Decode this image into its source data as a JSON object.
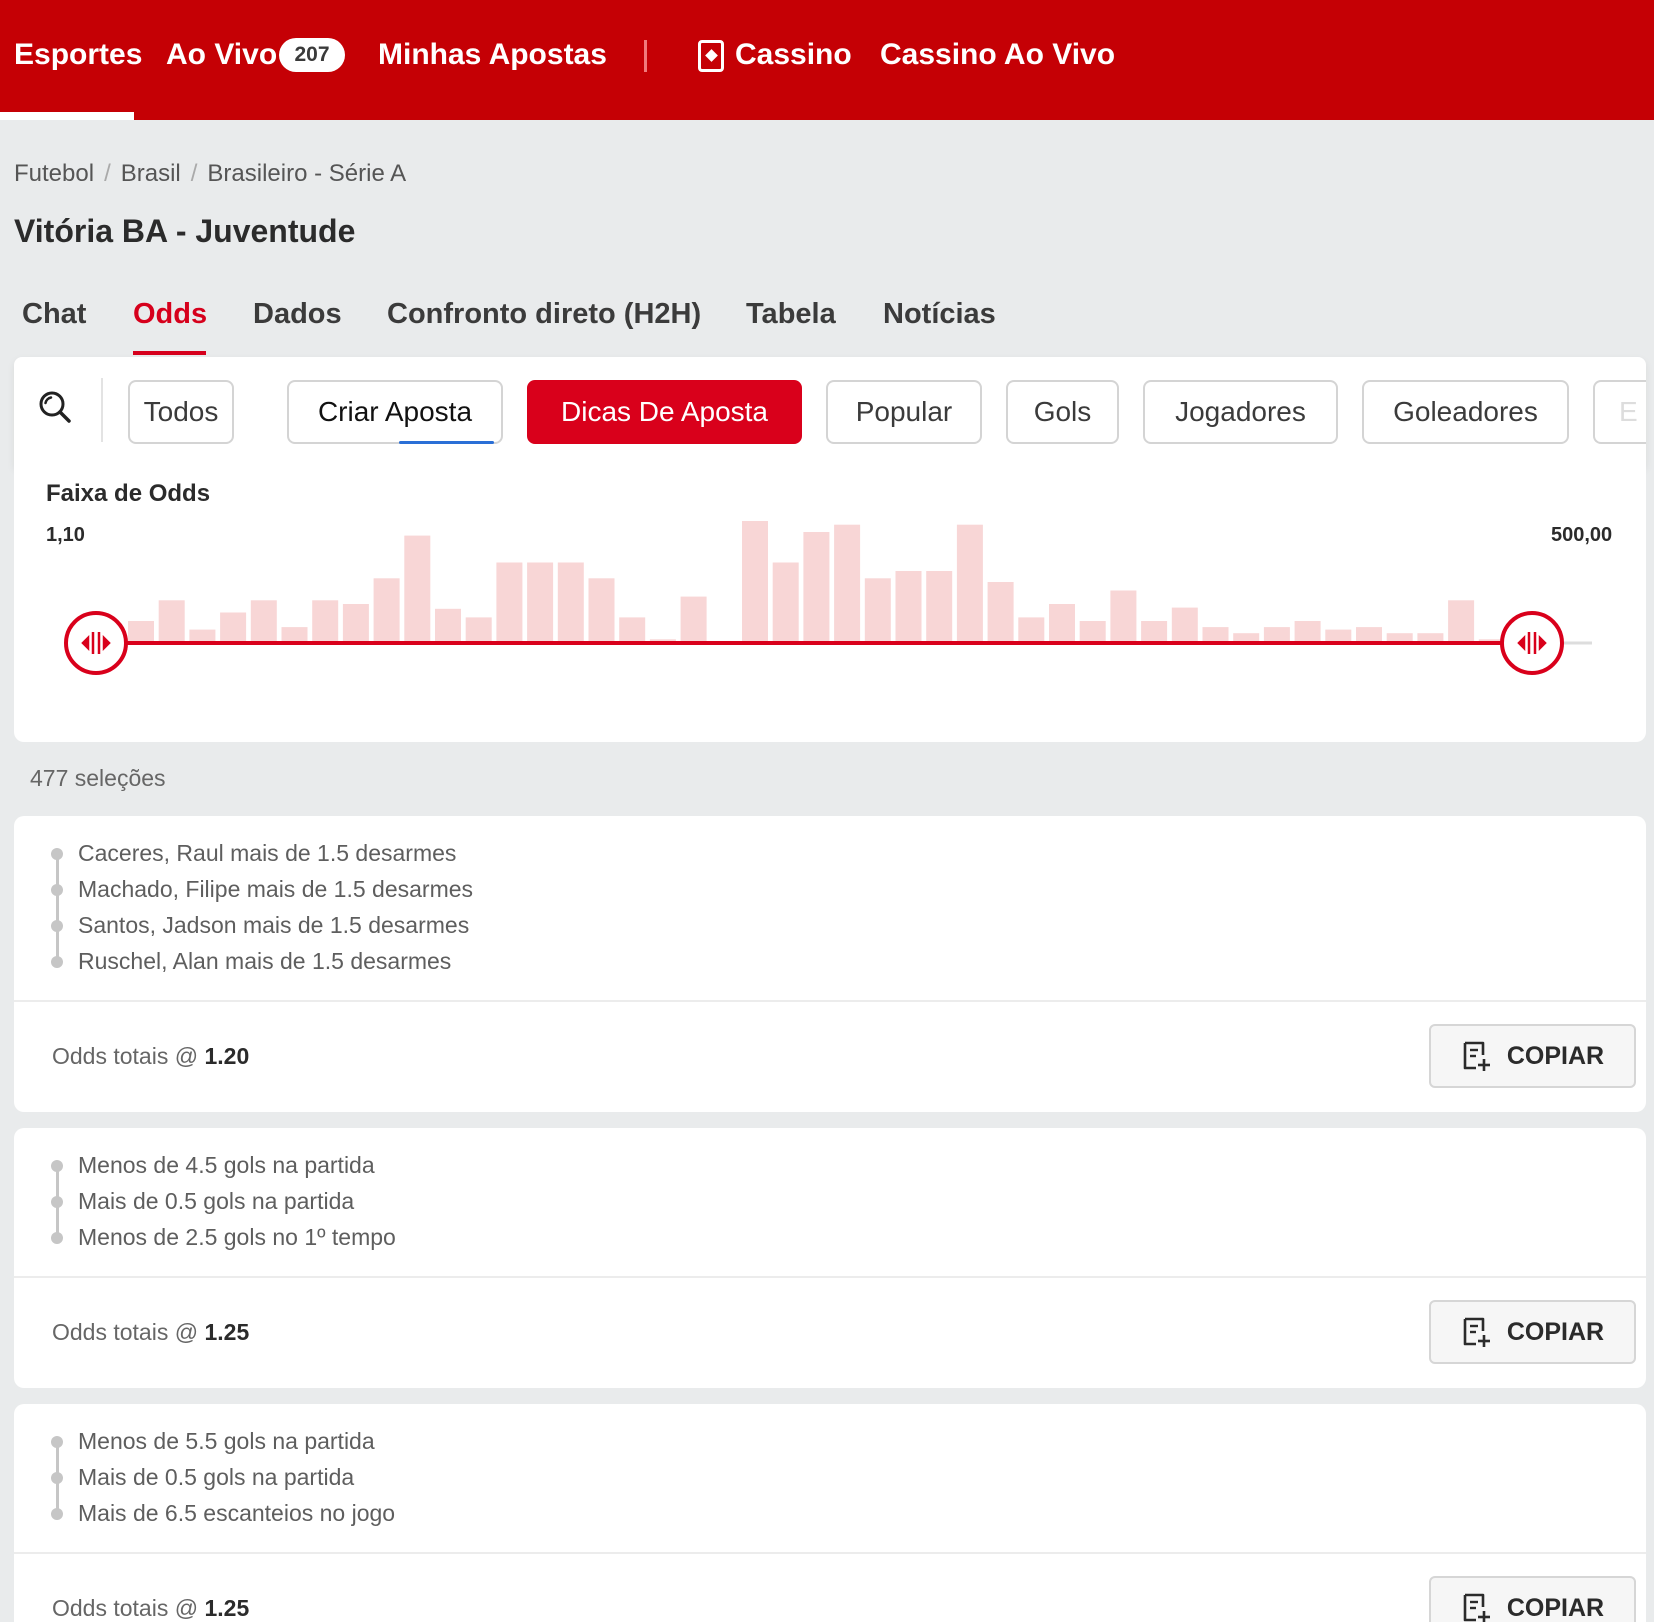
{
  "topnav": {
    "esportes": "Esportes",
    "ao_vivo": "Ao Vivo",
    "ao_vivo_count": "207",
    "minhas_apostas": "Minhas Apostas",
    "cassino": "Cassino",
    "cassino_ao_vivo": "Cassino Ao Vivo",
    "active_item": "Esportes",
    "brand_color": "#c50005"
  },
  "breadcrumb": [
    "Futebol",
    "Brasil",
    "Brasileiro - Série A"
  ],
  "page_title": "Vitória BA - Juventude",
  "tabs": [
    "Chat",
    "Odds",
    "Dados",
    "Confronto direto (H2H)",
    "Tabela",
    "Notícias"
  ],
  "active_tab": "Odds",
  "filters": [
    "Todos",
    "Criar Aposta",
    "Dicas De Aposta",
    "Popular",
    "Gols",
    "Jogadores",
    "Goleadores",
    "E"
  ],
  "active_filter": "Dicas De Aposta",
  "odds_range": {
    "title": "Faixa de Odds",
    "min_label": "1,10",
    "max_label": "500,00",
    "selected_min_fraction": 0.0,
    "selected_max_fraction": 1.0,
    "histogram_relative_heights": [
      0.18,
      0.35,
      0.11,
      0.25,
      0.35,
      0.13,
      0.35,
      0.32,
      0.53,
      0.88,
      0.28,
      0.21,
      0.66,
      0.66,
      0.66,
      0.53,
      0.21,
      0.03,
      0.38,
      0.0,
      1.0,
      0.66,
      0.91,
      0.97,
      0.53,
      0.59,
      0.59,
      0.97,
      0.5,
      0.21,
      0.32,
      0.18,
      0.43,
      0.18,
      0.29,
      0.13,
      0.08,
      0.13,
      0.18,
      0.11,
      0.13,
      0.08,
      0.08,
      0.35,
      0.03
    ],
    "accent_color": "#d9001b",
    "bar_color": "#f8d6d6"
  },
  "selection_count": "477 seleções",
  "odds_prefix": "Odds totais @",
  "copy_label": "COPIAR",
  "bets": [
    {
      "selections": [
        "Caceres, Raul mais de 1.5 desarmes",
        "Machado, Filipe mais de 1.5 desarmes",
        "Santos, Jadson mais de 1.5 desarmes",
        "Ruschel, Alan mais de 1.5 desarmes"
      ],
      "odds": "1.20"
    },
    {
      "selections": [
        "Menos de 4.5 gols na partida",
        "Mais de 0.5 gols na partida",
        "Menos de 2.5 gols no 1º tempo"
      ],
      "odds": "1.25"
    },
    {
      "selections": [
        "Menos de 5.5 gols na partida",
        "Mais de 0.5 gols na partida",
        "Mais de 6.5 escanteios no jogo"
      ],
      "odds": "1.25"
    }
  ]
}
